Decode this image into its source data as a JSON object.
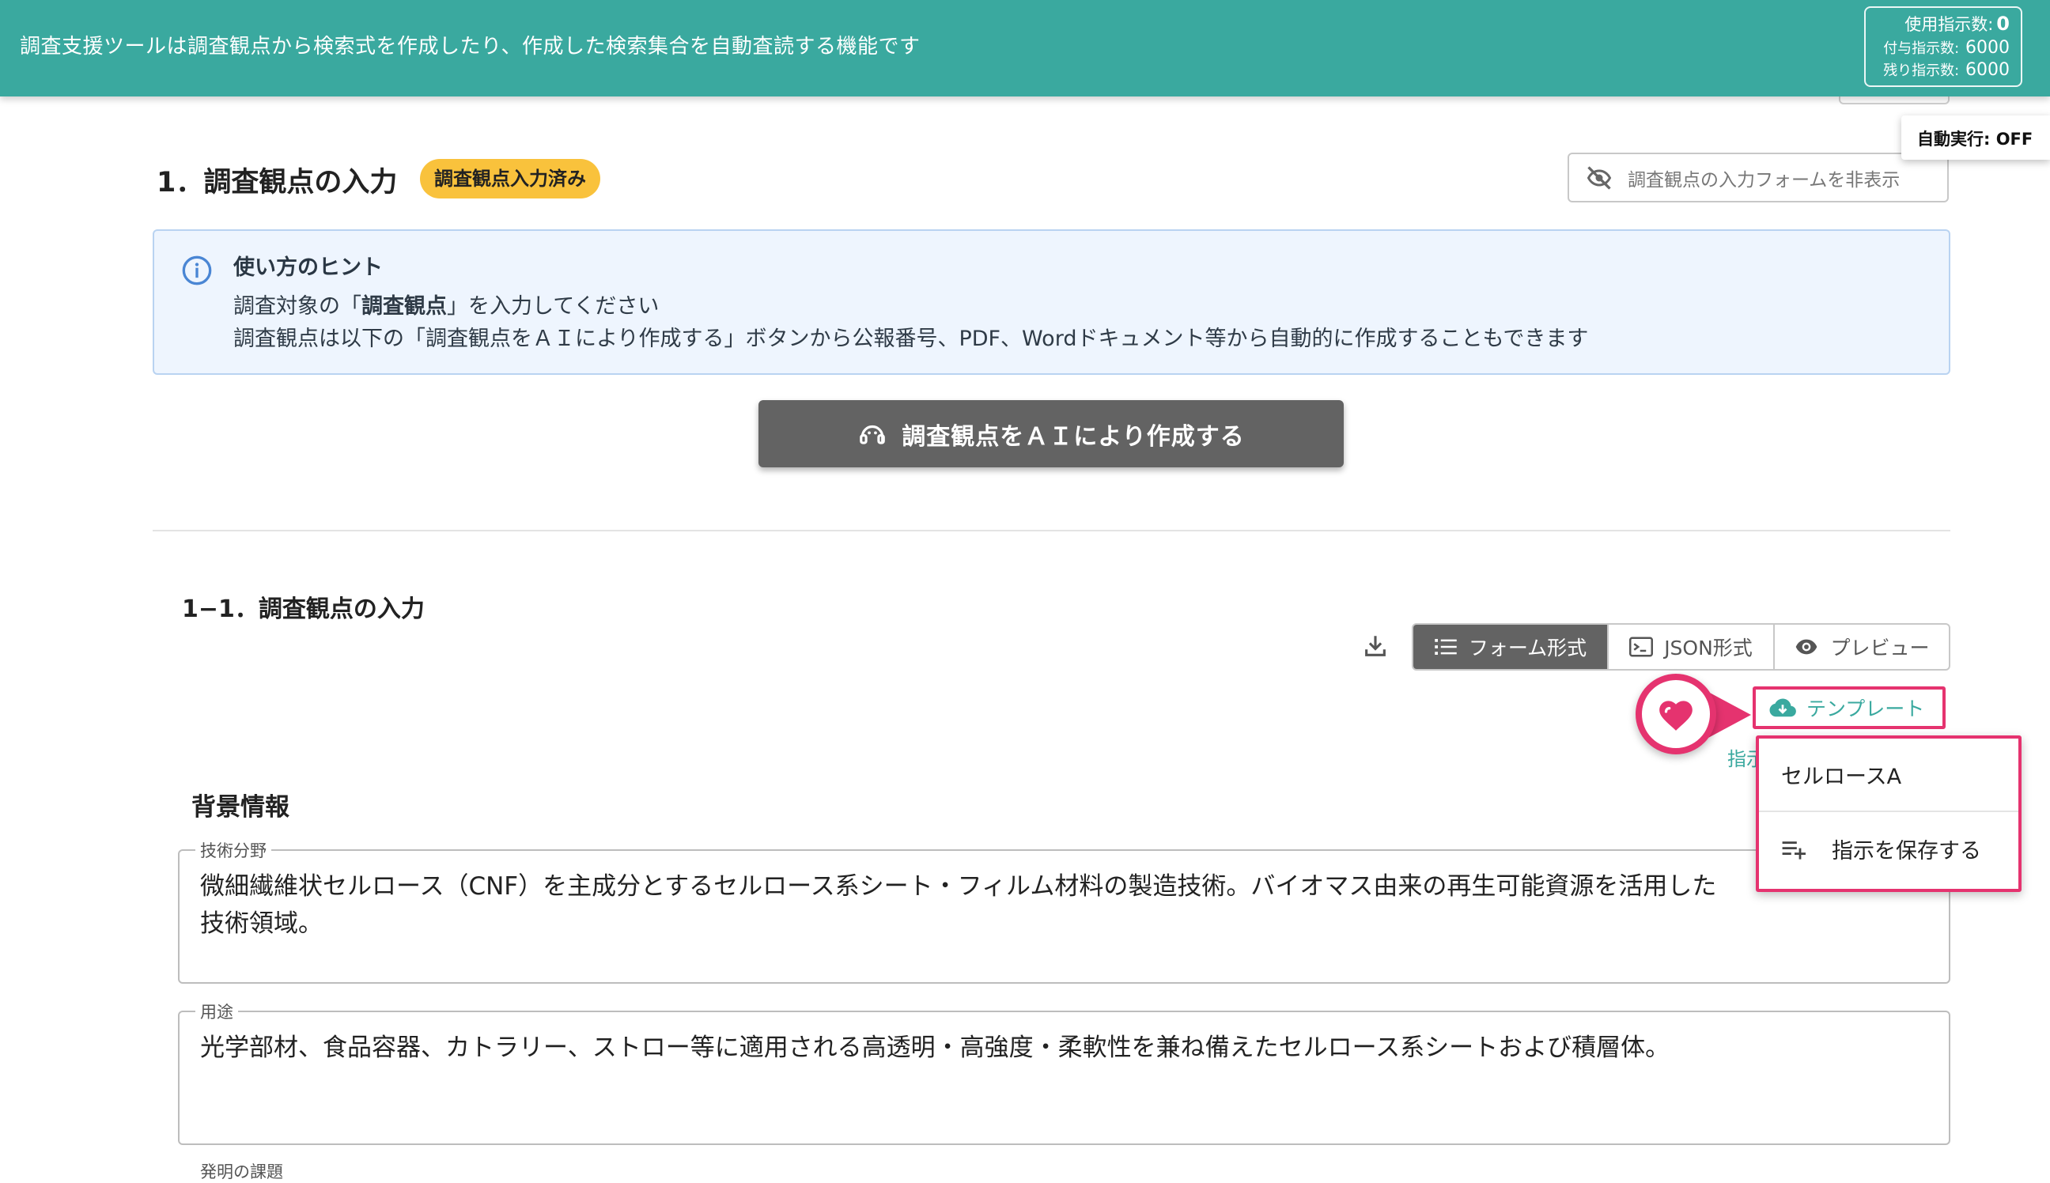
{
  "topbar": {
    "description": "調査支援ツールは調査観点から検索式を作成したり、作成した検索集合を自動査読する機能です",
    "usage": {
      "used_label": "使用指示数:",
      "used_value": "0",
      "given_label": "付与指示数:",
      "given_value": "6000",
      "remaining_label": "残り指示数:",
      "remaining_value": "6000"
    }
  },
  "auto_run": {
    "label": "自動実行: OFF"
  },
  "section1": {
    "title": "1．調査観点の入力",
    "badge": "調査観点入力済み",
    "hide_form_button": "調査観点の入力フォームを非表示",
    "hint": {
      "title": "使い方のヒント",
      "line1_prefix": "調査対象の「",
      "line1_bold": "調査観点",
      "line1_suffix": "」を入力してください",
      "line2": "調査観点は以下の「調査観点をＡＩにより作成する」ボタンから公報番号、PDF、Wordドキュメント等から自動的に作成することもできます"
    },
    "ai_button": "調査観点をＡＩにより作成する"
  },
  "section1_1": {
    "title": "1−1．調査観点の入力",
    "view_tabs": [
      "フォーム形式",
      "JSON形式",
      "プレビュー"
    ],
    "active_tab": "フォーム形式",
    "template_button": "テンプレート",
    "partial_link": "指示",
    "template_menu": {
      "items": [
        "セルロースA",
        "指示を保存する"
      ]
    },
    "background_title": "背景情報",
    "fields": [
      {
        "label": "技術分野",
        "value": "微細繊維状セルロース（CNF）を主成分とするセルロース系シート・フィルム材料の製造技術。バイオマス由来の再生可能資源を活用した\n技術領域。"
      },
      {
        "label": "用途",
        "value": "光学部材、食品容器、カトラリー、ストロー等に適用される高透明・高強度・柔軟性を兼ね備えたセルロース系シートおよび積層体。"
      },
      {
        "label": "発明の課題",
        "value": ""
      }
    ]
  },
  "colors": {
    "header_teal": "#3aa99f",
    "badge_yellow": "#f9c23c",
    "highlight_pink": "#e5336f",
    "dark_button": "#636363"
  }
}
